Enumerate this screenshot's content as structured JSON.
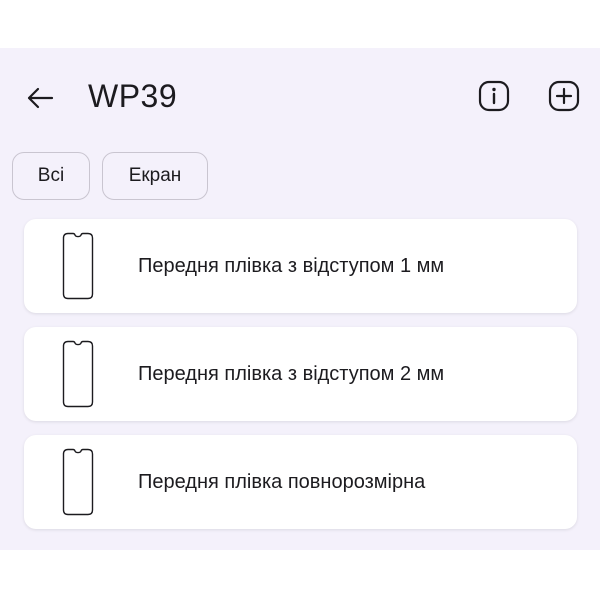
{
  "header": {
    "title": "WP39",
    "back_icon": "arrow-left-icon",
    "info_icon": "info-icon",
    "add_icon": "add-square-icon"
  },
  "filters": {
    "chips": [
      {
        "label": "Всі"
      },
      {
        "label": "Екран"
      }
    ]
  },
  "items": [
    {
      "label": "Передня плівка з відступом 1 мм",
      "icon": "phone-outline-icon"
    },
    {
      "label": "Передня плівка з відступом 2 мм",
      "icon": "phone-outline-icon"
    },
    {
      "label": "Передня плівка повнорозмірна",
      "icon": "phone-outline-icon"
    }
  ],
  "colors": {
    "background": "#f4f1fb",
    "card": "#ffffff",
    "text": "#1c1b1f",
    "chip_border": "#c9c5d0"
  }
}
